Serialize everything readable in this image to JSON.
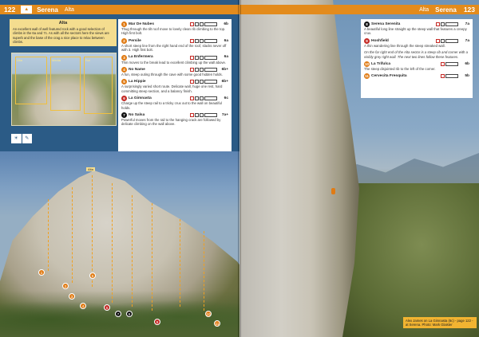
{
  "left_page": {
    "page_number": "122",
    "crag": "Serena",
    "sector": "Alta",
    "intro_title": "Alta",
    "intro_text": "An excellent wall of well featured rock with a good selection of climbs in the 6a and 7c. As with all the sectors here the views are superb and the base of the crag a nice place to relax between climbs.",
    "thumb_labels": [
      "Alta",
      "Media",
      "Sol"
    ],
    "routes": [
      {
        "num": "1",
        "color": "orange",
        "name": "Mar De Nubes",
        "grade": "6b",
        "desc": "Thug through the tilt roof move to lovely clean rib climbing to the top. High first bolt."
      },
      {
        "num": "2",
        "color": "orange",
        "name": "Persile",
        "grade": "6a",
        "desc": "A short steep line from the right hand end of the roof, slacks never off with 3. High first bolt."
      },
      {
        "num": "3",
        "color": "orange",
        "name": "La Enfermera",
        "grade": "6a",
        "desc": "Thin moves to the break lead to excellent climbing up the wall above."
      },
      {
        "num": "4",
        "color": "orange",
        "name": "No Name",
        "grade": "6b+",
        "desc": "A fun, steep outing through the cave with some good hidden holds."
      },
      {
        "num": "5",
        "color": "orange",
        "name": "La Hippie",
        "grade": "6b+",
        "desc": "A surprisingly varied short route. Delicate wall, huge one rest, hard committing steep section, and a balancy finish."
      },
      {
        "num": "6",
        "color": "red",
        "name": "La Gimnasta",
        "grade": "6c",
        "desc": "Charge up the steep rail to a tricky crux out to the wall on beautiful holds."
      },
      {
        "num": "7",
        "color": "black",
        "name": "No Salsa",
        "grade": "7a+",
        "desc": "Powerful moves from the rail to the hanging crack are followed by delicate climbing on the wall above."
      }
    ],
    "photo_pins": [
      "1",
      "2",
      "3",
      "4",
      "5",
      "6",
      "7",
      "8",
      "9",
      "10",
      "11"
    ],
    "photo_tag": "Alta"
  },
  "right_page": {
    "page_number": "123",
    "crag": "Serena",
    "sector": "Alta",
    "routes": [
      {
        "num": "8",
        "color": "black",
        "name": "Serena Serenita",
        "grade": "7a",
        "desc": "A beautiful long line straight up the steep wall that features a creepy crux."
      },
      {
        "num": "9",
        "color": "red",
        "name": "Hoshfield",
        "grade": "7a",
        "desc": "A thin wandering line through the steep streaked wall."
      }
    ],
    "note": "On the far right end of the Alta sector is a steep rib and corner with a visibly grey right wall. The next two lines follow these features.",
    "routes2": [
      {
        "num": "10",
        "color": "orange",
        "name": "La Trifulca",
        "grade": "6b",
        "desc": "The steep disjointed rib to the left of the corner."
      },
      {
        "num": "11",
        "color": "orange",
        "name": "Cervecita Fresquita",
        "grade": "5b",
        "desc": ""
      }
    ],
    "caption": "Alex James on La Gimnasta (6c) - page 122 - at Serena. Photo: Mark Glaister"
  }
}
